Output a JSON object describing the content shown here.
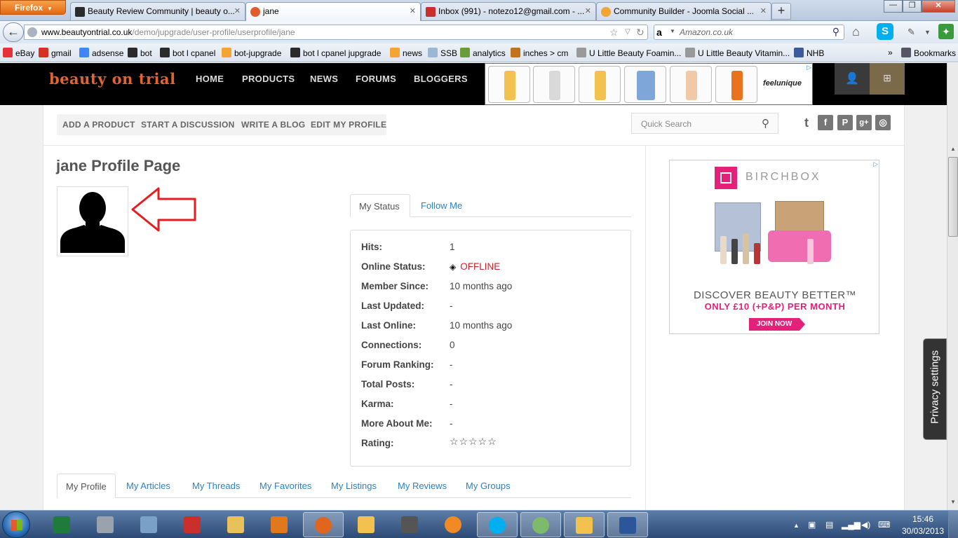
{
  "browser": {
    "app_button": "Firefox",
    "tabs": [
      {
        "label": "Beauty Review Community | beauty o...",
        "color": "#2b2b2b"
      },
      {
        "label": "jane",
        "color": "#e35b2b"
      },
      {
        "label": "Inbox (991) - notezo12@gmail.com - ...",
        "color": "#c9302c"
      },
      {
        "label": "Community Builder - Joomla Social ...",
        "color": "#f3a534"
      }
    ],
    "new_tab": "+",
    "url_host": "www.beautyontrial.co.uk",
    "url_path": "/demo/jupgrade/user-profile/userprofile/jane",
    "search_placeholder": "Amazon.co.uk",
    "bookmarks": [
      {
        "label": "eBay",
        "color": "#e53238"
      },
      {
        "label": "gmail",
        "color": "#d93025"
      },
      {
        "label": "adsense",
        "color": "#4285f4"
      },
      {
        "label": "bot",
        "color": "#2b2b2b"
      },
      {
        "label": "bot l cpanel",
        "color": "#2b2b2b"
      },
      {
        "label": "bot-jupgrade",
        "color": "#f3a534"
      },
      {
        "label": "bot l cpanel  jupgrade",
        "color": "#2b2b2b"
      },
      {
        "label": "news",
        "color": "#f3a534"
      },
      {
        "label": "SSB",
        "color": "#9bb7d4"
      },
      {
        "label": "analytics",
        "color": "#6a9d3a"
      },
      {
        "label": "inches > cm",
        "color": "#c0731a"
      },
      {
        "label": "U Little Beauty Foamin...",
        "color": "#999999"
      },
      {
        "label": "U Little Beauty Vitamin...",
        "color": "#999999"
      },
      {
        "label": "NHB",
        "color": "#3c5a99"
      }
    ],
    "bookmarks_overflow": "»",
    "bookmarks_menu": "Bookmarks"
  },
  "site": {
    "logo": "beauty on trial",
    "nav": [
      "HOME",
      "PRODUCTS",
      "NEWS",
      "FORUMS",
      "BLOGGERS"
    ],
    "ad_brand": "feelunique",
    "ad_products": [
      "#f2c14e",
      "#d9d9d9",
      "#f2c14e",
      "#7ea6d8",
      "#f1c9a6",
      "#e8731c"
    ],
    "actions": [
      "ADD A PRODUCT",
      "START A DISCUSSION",
      "WRITE A BLOG",
      "EDIT MY PROFILE"
    ],
    "quick_search_placeholder": "Quick Search",
    "social": [
      "t",
      "f",
      "P",
      "g+",
      "◎"
    ]
  },
  "profile": {
    "title": "jane Profile Page",
    "tabs": {
      "status": "My Status",
      "follow": "Follow Me"
    },
    "fields": [
      {
        "label": "Hits:",
        "value": "1"
      },
      {
        "label": "Online Status:",
        "value": "OFFLINE"
      },
      {
        "label": "Member Since:",
        "value": "10 months ago"
      },
      {
        "label": "Last Updated:",
        "value": "-"
      },
      {
        "label": "Last Online:",
        "value": "10 months ago"
      },
      {
        "label": "Connections:",
        "value": "0"
      },
      {
        "label": "Forum Ranking:",
        "value": "-"
      },
      {
        "label": "Total Posts:",
        "value": "-"
      },
      {
        "label": "Karma:",
        "value": "-"
      },
      {
        "label": "More About Me:",
        "value": "-"
      },
      {
        "label": "Rating:",
        "value": "☆☆☆☆☆"
      }
    ],
    "subtabs": [
      "My Profile",
      "My Articles",
      "My Threads",
      "My Favorites",
      "My Listings",
      "My Reviews",
      "My Groups"
    ]
  },
  "birchbox_ad": {
    "logo": "BIRCHBOX",
    "line1": "DISCOVER BEAUTY BETTER™",
    "line2": "ONLY £10 (+P&P) PER MONTH",
    "cta": "JOIN NOW"
  },
  "privacy_settings": "Privacy settings",
  "taskbar": {
    "apps": [
      {
        "name": "excel",
        "color": "#1f7a3c"
      },
      {
        "name": "scanner",
        "color": "#9aa3ad"
      },
      {
        "name": "calculator",
        "color": "#7ba0c8"
      },
      {
        "name": "acrobat",
        "color": "#c9302c"
      },
      {
        "name": "explorer",
        "color": "#e8c15a"
      },
      {
        "name": "office",
        "color": "#e0781e"
      },
      {
        "name": "firefox",
        "color": "#e0651e"
      },
      {
        "name": "drive",
        "color": "#f2c14e"
      },
      {
        "name": "camera",
        "color": "#555555"
      },
      {
        "name": "media",
        "color": "#f08a24"
      },
      {
        "name": "skype",
        "color": "#00aff0"
      },
      {
        "name": "globe",
        "color": "#7dba6a"
      },
      {
        "name": "security",
        "color": "#f2c14e"
      },
      {
        "name": "word",
        "color": "#2b579a"
      }
    ],
    "time": "15:46",
    "date": "30/03/2013"
  }
}
